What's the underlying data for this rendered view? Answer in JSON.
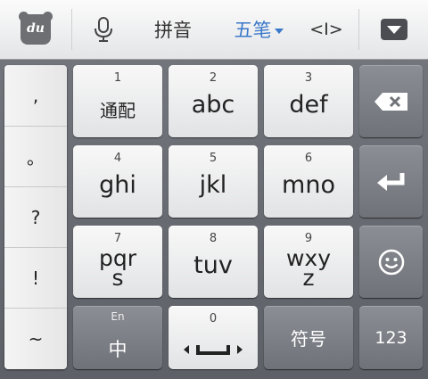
{
  "toolbar": {
    "logo_text": "du",
    "pinyin_label": "拼音",
    "wubi_label": "五笔",
    "cursor_label": "<I>",
    "icons": {
      "logo": "baidu-paw-logo",
      "mic": "microphone-icon",
      "collapse": "triangle-down-icon",
      "cursor": "cursor-icon"
    }
  },
  "punctuation": [
    ",",
    "。",
    "?",
    "!",
    "~"
  ],
  "keys": [
    {
      "num": "1",
      "label": "通配"
    },
    {
      "num": "2",
      "label": "abc"
    },
    {
      "num": "3",
      "label": "def"
    },
    {
      "num": "4",
      "label": "ghi"
    },
    {
      "num": "5",
      "label": "jkl"
    },
    {
      "num": "6",
      "label": "mno"
    },
    {
      "num": "7",
      "label": "pqr\ns"
    },
    {
      "num": "8",
      "label": "tuv"
    },
    {
      "num": "9",
      "label": "wxy\nz"
    }
  ],
  "bottom": {
    "lang_small": "En",
    "lang_main": "中",
    "space_num": "0",
    "symbols": "符号",
    "numbers": "123"
  },
  "colors": {
    "accent": "#3a78c9",
    "dark_key": "#7c7f85",
    "light_key": "#ececee"
  }
}
